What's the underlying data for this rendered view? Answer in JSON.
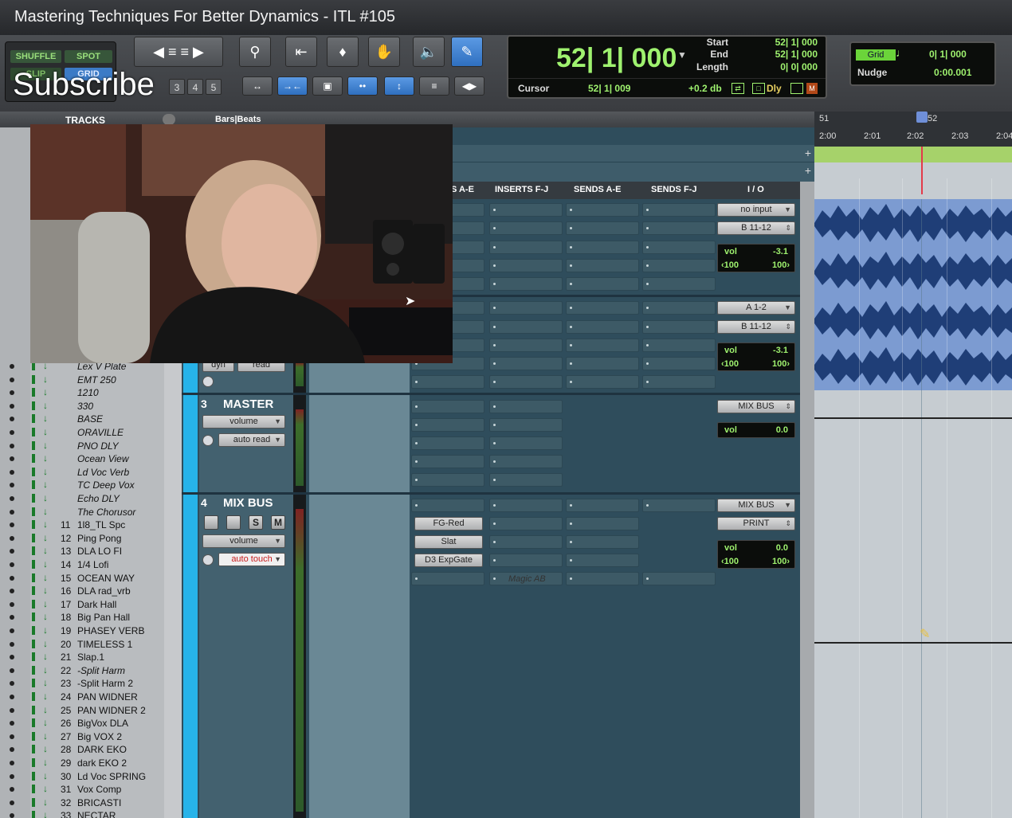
{
  "window": {
    "title": "Mastering Techniques For Better Dynamics - ITL #105"
  },
  "overlay": {
    "subscribe": "Subscribe"
  },
  "toolbar": {
    "modes": {
      "shuffle": "SHUFFLE",
      "spot": "SPOT",
      "slip": "SLIP",
      "grid": "GRID"
    },
    "zoom_presets": [
      "3",
      "4",
      "5"
    ]
  },
  "counter": {
    "main": "52| 1| 000",
    "start_label": "Start",
    "start_value": "52| 1| 000",
    "end_label": "End",
    "end_value": "52| 1| 000",
    "length_label": "Length",
    "length_value": "0| 0| 000",
    "cursor_label": "Cursor",
    "cursor_value": "52| 1| 009",
    "db_value": "+0.2 db",
    "dly_label": "Dly"
  },
  "grid": {
    "grid_label": "Grid",
    "grid_value": "0| 1| 000",
    "nudge_label": "Nudge",
    "nudge_value": "0:00.001"
  },
  "tracks_header": {
    "label": "TRACKS"
  },
  "ruler": {
    "label": "Bars|Beats",
    "bars": [
      "51",
      "52"
    ],
    "times": [
      "2:00",
      "2:01",
      "2:02",
      "2:03",
      "2:04"
    ]
  },
  "mix_columns": {
    "sends_ae_left": "S A-E",
    "inserts_fj": "INSERTS F-J",
    "sends_ae": "SENDS A-E",
    "sends_fj": "SENDS F-J",
    "io": "I / O"
  },
  "track_list": [
    {
      "num": "",
      "name": "Lex V Plate",
      "italic": true
    },
    {
      "num": "",
      "name": "EMT 250",
      "italic": true
    },
    {
      "num": "",
      "name": "1210",
      "italic": true
    },
    {
      "num": "",
      "name": "330",
      "italic": true
    },
    {
      "num": "",
      "name": "BASE",
      "italic": true
    },
    {
      "num": "",
      "name": "ORAVILLE",
      "italic": true
    },
    {
      "num": "",
      "name": "PNO DLY",
      "italic": true
    },
    {
      "num": "",
      "name": "Ocean View",
      "italic": true
    },
    {
      "num": "",
      "name": "Ld Voc Verb",
      "italic": true
    },
    {
      "num": "",
      "name": "TC Deep Vox",
      "italic": true
    },
    {
      "num": "",
      "name": "Echo DLY",
      "italic": true
    },
    {
      "num": "",
      "name": "The Chorusor",
      "italic": true
    },
    {
      "num": "11",
      "name": "1l8_TL Spc",
      "italic": false
    },
    {
      "num": "12",
      "name": "Ping Pong",
      "italic": false
    },
    {
      "num": "13",
      "name": "DLA  LO FI",
      "italic": false
    },
    {
      "num": "14",
      "name": "1/4 Lofi",
      "italic": false
    },
    {
      "num": "15",
      "name": "OCEAN WAY",
      "italic": false
    },
    {
      "num": "16",
      "name": "DLA  rad_vrb",
      "italic": false
    },
    {
      "num": "17",
      "name": "Dark Hall",
      "italic": false
    },
    {
      "num": "18",
      "name": "Big Pan Hall",
      "italic": false
    },
    {
      "num": "19",
      "name": "PHASEY VERB",
      "italic": false
    },
    {
      "num": "20",
      "name": "TIMELESS 1",
      "italic": false
    },
    {
      "num": "21",
      "name": "Slap.1",
      "italic": false
    },
    {
      "num": "22",
      "name": "-Split Harm",
      "italic": true
    },
    {
      "num": "23",
      "name": "-Split Harm 2",
      "italic": false
    },
    {
      "num": "24",
      "name": "PAN WIDNER",
      "italic": false
    },
    {
      "num": "25",
      "name": "PAN WIDNER 2",
      "italic": false
    },
    {
      "num": "26",
      "name": "BigVox DLA",
      "italic": false
    },
    {
      "num": "27",
      "name": "Big VOX 2",
      "italic": false
    },
    {
      "num": "28",
      "name": "DARK EKO",
      "italic": false
    },
    {
      "num": "29",
      "name": "dark EKO 2",
      "italic": false
    },
    {
      "num": "30",
      "name": "Ld Voc SPRING",
      "italic": false
    },
    {
      "num": "31",
      "name": "Vox Comp",
      "italic": false
    },
    {
      "num": "32",
      "name": "BRICASTI",
      "italic": false
    },
    {
      "num": "33",
      "name": "NECTAR",
      "italic": false
    }
  ],
  "strips": {
    "top1": {
      "io_in": "no input",
      "io_out": "B 11-12",
      "vol_label": "vol",
      "vol": "-3.1",
      "pan_l": "‹100",
      "pan_r": "100›"
    },
    "top2": {
      "io_in": "A 1-2",
      "io_out": "B 11-12",
      "vol_label": "vol",
      "vol": "-3.1",
      "pan_l": "‹100",
      "pan_r": "100›",
      "auto_view": "dyn",
      "auto_mode": "read"
    },
    "master": {
      "num": "3",
      "name": "MASTER",
      "view": "volume",
      "auto": "auto read",
      "io_out": "MIX BUS",
      "vol_label": "vol",
      "vol": "0.0"
    },
    "mixbus": {
      "num": "4",
      "name": "MIX BUS",
      "view": "volume",
      "auto": "auto touch",
      "s_label": "S",
      "m_label": "M",
      "inserts": [
        "FG-Red",
        "Slat",
        "D3 ExpGate"
      ],
      "insert_fj": "Magic AB",
      "io_in": "MIX BUS",
      "io_out": "PRINT",
      "vol_label": "vol",
      "vol": "0.0",
      "pan_l": "‹100",
      "pan_r": "100›"
    }
  },
  "colors": {
    "counter_green": "#9ff26f",
    "track_blue": "#27b3e9",
    "clip_blue": "#7c9bd1",
    "playhead_red": "#e33a4a"
  }
}
